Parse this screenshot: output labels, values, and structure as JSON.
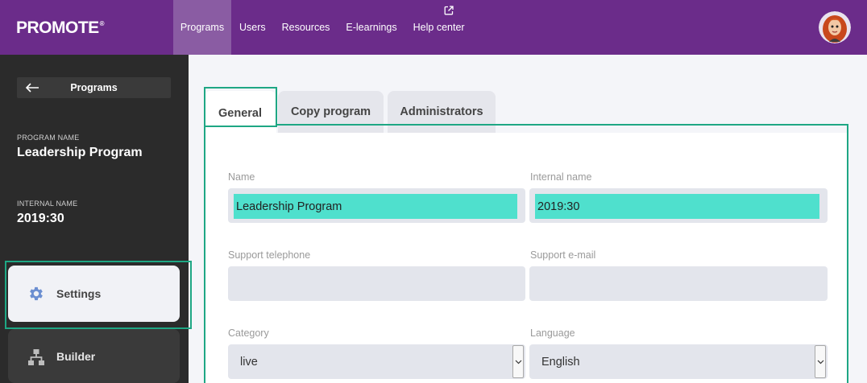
{
  "topbar": {
    "logo": "PROMOTE",
    "logo_mark": "®",
    "nav": [
      {
        "label": "Programs",
        "active": true
      },
      {
        "label": "Users"
      },
      {
        "label": "Resources"
      },
      {
        "label": "E-learnings"
      },
      {
        "label": "Help center",
        "icon": "external-link-icon"
      }
    ],
    "avatar_icon": "avatar"
  },
  "sidebar": {
    "back_label": "Programs",
    "back_icon": "arrow-left-icon",
    "program_name_label": "PROGRAM NAME",
    "program_name": "Leadership Program",
    "internal_name_label": "INTERNAL NAME",
    "internal_name": "2019:30",
    "menu": [
      {
        "label": "Settings",
        "icon": "gear-icon",
        "active": true
      },
      {
        "label": "Builder",
        "icon": "sitemap-icon"
      }
    ]
  },
  "tabs": [
    {
      "label": "General",
      "active": true
    },
    {
      "label": "Copy program"
    },
    {
      "label": "Administrators"
    }
  ],
  "form": {
    "name_label": "Name",
    "name_value": "Leadership Program",
    "internal_name_label": "Internal name",
    "internal_name_value": "2019:30",
    "support_tel_label": "Support telephone",
    "support_tel_value": "",
    "support_email_label": "Support e-mail",
    "support_email_value": "",
    "category_label": "Category",
    "category_value": "live",
    "language_label": "Language",
    "language_value": "English"
  },
  "colors": {
    "topbar": "#6b2c8a",
    "sidebar": "#2b2b2b",
    "highlight": "#4fe0cd",
    "annotation": "#1ea784"
  }
}
